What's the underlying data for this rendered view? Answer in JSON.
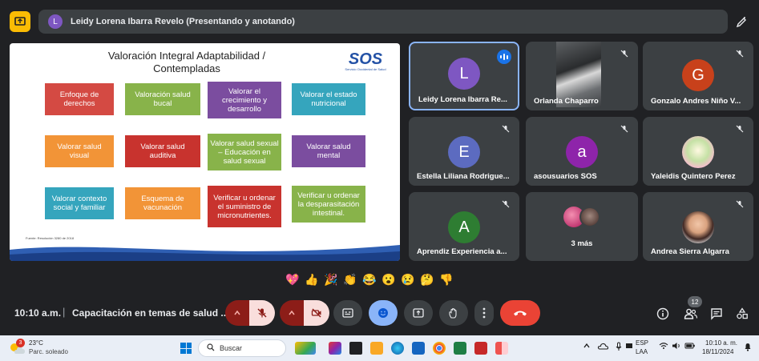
{
  "presentation": {
    "presenter_avatar_letter": "L",
    "presenter_label": "Leidy Lorena Ibarra Revelo (Presentando y anotando)"
  },
  "slide": {
    "title": "Valoración Integral Adaptabilidad / Contempladas",
    "logo_text": "SOS",
    "logo_subtext": "Servicio Occidental de Salud",
    "cards": [
      "Enfoque de derechos",
      "Valoración salud bucal",
      "Valorar el crecimiento y desarrollo",
      "Valorar el estado nutricional",
      "Valorar salud visual",
      "Valorar salud auditiva",
      "Valorar salud sexual – Educación en salud sexual",
      "Valorar salud mental",
      "Valorar contexto social y familiar",
      "Esquema de vacunación",
      "Verificar u ordenar el suministro de micronutrientes.",
      "Verificar u ordenar la desparasitación intestinal."
    ],
    "footer_note": "Fuente: Resolución 3280 de 2018"
  },
  "participants": [
    {
      "name": "Leidy Lorena Ibarra Re...",
      "initial": "L",
      "color": "#7e57c2",
      "speaking": true
    },
    {
      "name": "Orlanda Chaparro",
      "initial": "",
      "muted": true,
      "video": true
    },
    {
      "name": "Gonzalo Andres Niño V...",
      "initial": "G",
      "color": "#c8411b",
      "muted": true
    },
    {
      "name": "Estella Liliana Rodrigue...",
      "initial": "E",
      "color": "#5c6bc0",
      "muted": true
    },
    {
      "name": "asousuarios SOS",
      "initial": "a",
      "color": "#8e24aa",
      "muted": true
    },
    {
      "name": "Yaleidis Quintero Perez",
      "initial": "",
      "muted": true,
      "photo": true
    },
    {
      "name": "Aprendiz Experiencia a...",
      "initial": "A",
      "color": "#2e7d32",
      "muted": true
    },
    {
      "name": "3 más",
      "initial": ""
    },
    {
      "name": "Andrea Sierra Algarra",
      "initial": "",
      "muted": true,
      "photo": true
    }
  ],
  "reactions": [
    "💖",
    "👍",
    "🎉",
    "👏",
    "😂",
    "😮",
    "😢",
    "🤔",
    "👎"
  ],
  "meeting": {
    "time": "10:10 a.m.",
    "separator": "|",
    "title": "Capacitación en temas de salud ...",
    "people_count": "12"
  },
  "taskbar": {
    "weather_badge": "3",
    "temperature": "23°C",
    "weather_desc": "Parc. soleado",
    "search_placeholder": "Buscar",
    "lang_line1": "ESP",
    "lang_line2": "LAA",
    "clock_time": "10:10 a. m.",
    "clock_date": "18/11/2024"
  },
  "colors": {
    "meet_background": "#202124",
    "tile_background": "#3c4043",
    "accent_blue": "#8ab4f8",
    "end_call_red": "#ea4335",
    "presenter_yellow": "#fbbc04"
  }
}
